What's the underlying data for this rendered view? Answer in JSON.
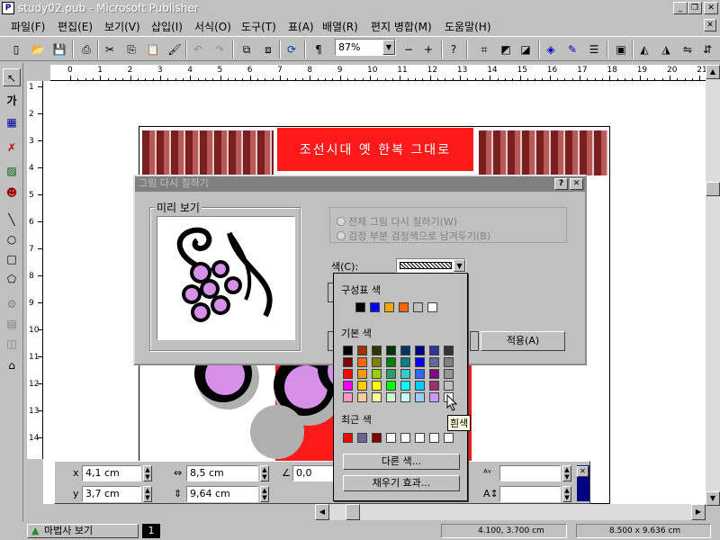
{
  "window": {
    "title": "study02.pub - Microsoft Publisher",
    "icon": "publisher-app-icon"
  },
  "menu": [
    "파일(F)",
    "편집(E)",
    "보기(V)",
    "삽입(I)",
    "서식(O)",
    "도구(T)",
    "표(A)",
    "배열(R)",
    "편지 병합(M)",
    "도움말(H)"
  ],
  "toolbar": {
    "zoom": "87%"
  },
  "ruler": {
    "h_ticks": [
      "0",
      "1",
      "2",
      "3",
      "4",
      "5",
      "6",
      "7",
      "8",
      "9",
      "10",
      "11",
      "12",
      "13",
      "14",
      "15",
      "16",
      "17",
      "18",
      "19",
      "20",
      "21"
    ],
    "v_ticks": [
      "1",
      "2",
      "3",
      "4",
      "5",
      "6",
      "7",
      "8",
      "9",
      "10",
      "11",
      "12",
      "13",
      "14"
    ]
  },
  "document": {
    "banner_text": "조선시대 옛 한복 그대로"
  },
  "measure": {
    "x_label": "x",
    "x_value": "4,1 cm",
    "y_label": "y",
    "y_value": "3,7 cm",
    "width_value": "8,5 cm",
    "height_value": "9,64 cm",
    "rotation_value": "0,0"
  },
  "dialog": {
    "title": "그림 다시 칠하기",
    "preview_label": "미리 보기",
    "option_all": "전체 그림 다시 칠하기(W)",
    "option_keep_black": "검정 부분 검정색으로 남겨두기(B)",
    "color_label": "색(C):",
    "apply_label": "적용(A)"
  },
  "color_popup": {
    "scheme_label": "구성표 색",
    "scheme_colors": [
      "#000000",
      "#0000ff",
      "#ffa500",
      "#ff6600",
      "#c0c0c0",
      "#ffffff"
    ],
    "basic_label": "기본 색",
    "basic_colors": [
      [
        "#000000",
        "#993300",
        "#333300",
        "#003300",
        "#003366",
        "#000080",
        "#333399",
        "#333333"
      ],
      [
        "#800000",
        "#ff6600",
        "#808000",
        "#008000",
        "#008080",
        "#0000ff",
        "#666699",
        "#808080"
      ],
      [
        "#ff0000",
        "#ff9900",
        "#99cc00",
        "#339966",
        "#33cccc",
        "#3366ff",
        "#800080",
        "#969696"
      ],
      [
        "#ff00ff",
        "#ffcc00",
        "#ffff00",
        "#00ff00",
        "#00ffff",
        "#00ccff",
        "#993366",
        "#c0c0c0"
      ],
      [
        "#ff99cc",
        "#ffcc99",
        "#ffff99",
        "#ccffcc",
        "#ccffff",
        "#99ccff",
        "#cc99ff",
        "#ffffff"
      ]
    ],
    "recent_label": "최근 색",
    "recent_colors": [
      "#ff0000",
      "#666699",
      "#800000",
      "#ffffff",
      "#ffffff",
      "#ffffff",
      "#ffffff",
      "#ffffff"
    ],
    "more_colors": "다른 색...",
    "fill_effects": "채우기 효과...",
    "tooltip": "흰색"
  },
  "status": {
    "wizard": "마법사 보기",
    "page": "1",
    "position": "4.100, 3.700 cm",
    "size": "8.500 x  9.636 cm"
  }
}
